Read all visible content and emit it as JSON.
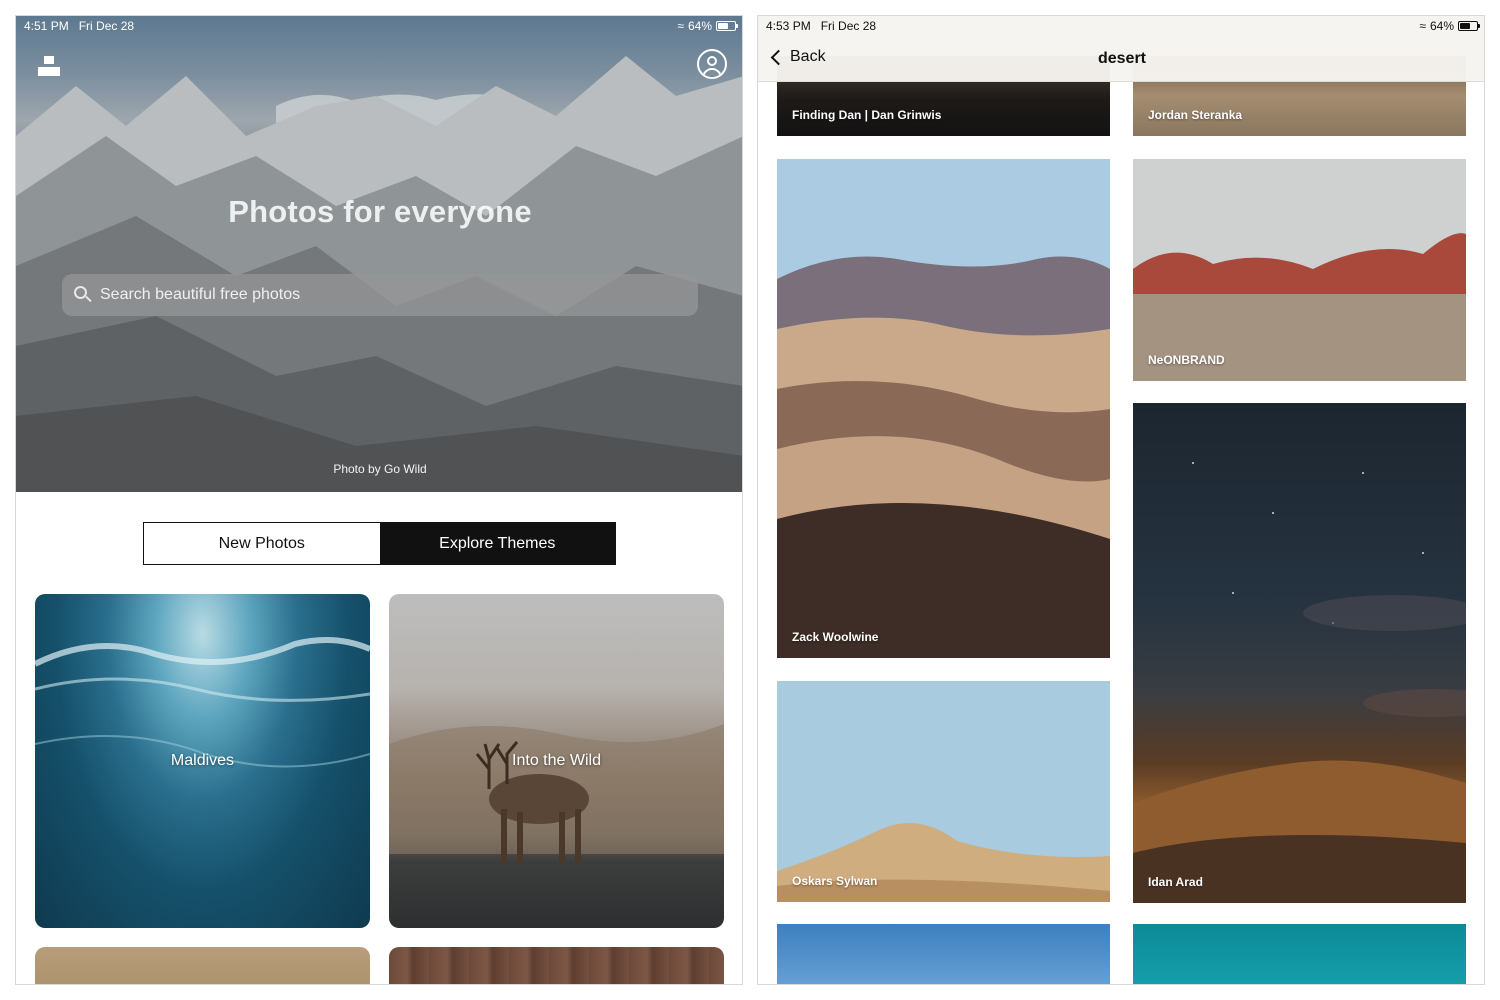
{
  "left_screen": {
    "status": {
      "time": "4:51 PM",
      "date": "Fri Dec 28",
      "battery": "64%",
      "battery_level": 0.64
    },
    "hero": {
      "title": "Photos for everyone",
      "search_placeholder": "Search beautiful free photos",
      "credit": "Photo by Go Wild"
    },
    "segmented": {
      "new_photos": "New Photos",
      "explore_themes": "Explore Themes",
      "selected": "Explore Themes"
    },
    "themes": [
      {
        "label": "Maldives"
      },
      {
        "label": "Into the Wild"
      }
    ]
  },
  "right_screen": {
    "status": {
      "time": "4:53 PM",
      "date": "Fri Dec 28",
      "battery": "64%",
      "battery_level": 0.64
    },
    "nav": {
      "back_label": "Back",
      "title": "desert"
    },
    "photos": [
      {
        "author": "Finding Dan | Dan Grinwis"
      },
      {
        "author": "Jordan Steranka"
      },
      {
        "author": "Zack Woolwine"
      },
      {
        "author": "NeONBRAND"
      },
      {
        "author": "Oskars Sylwan"
      },
      {
        "author": "Idan Arad"
      }
    ]
  }
}
